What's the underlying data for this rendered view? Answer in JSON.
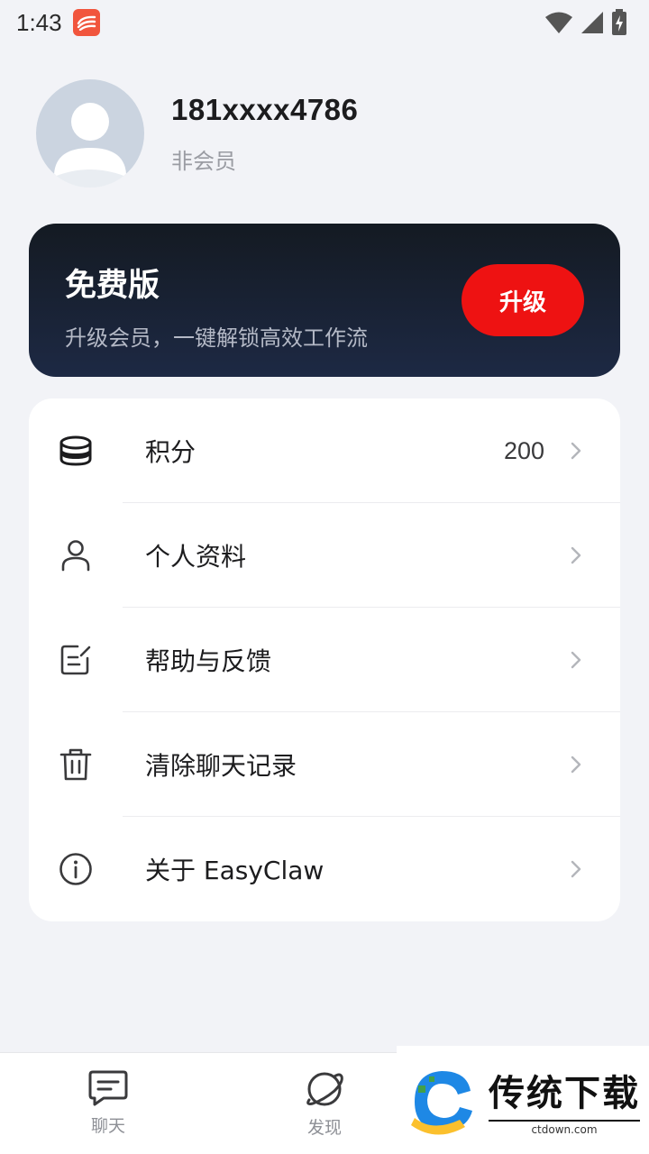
{
  "status_bar": {
    "time": "1:43",
    "icons": [
      "app-notification-icon",
      "wifi-icon",
      "cell-signal-icon",
      "battery-charging-icon"
    ]
  },
  "profile": {
    "username": "181xxxx4786",
    "member_status": "非会员",
    "avatar_icon": "user-avatar-placeholder-icon"
  },
  "plan_card": {
    "title": "免费版",
    "description": "升级会员，一键解锁高效工作流",
    "upgrade_label": "升级"
  },
  "menu": {
    "items": [
      {
        "label": "积分",
        "value": "200",
        "icon": "coins-stack-icon"
      },
      {
        "label": "个人资料",
        "value": "",
        "icon": "person-icon"
      },
      {
        "label": "帮助与反馈",
        "value": "",
        "icon": "edit-note-icon"
      },
      {
        "label": "清除聊天记录",
        "value": "",
        "icon": "trash-icon"
      },
      {
        "label": "关于 EasyClaw",
        "value": "",
        "icon": "info-icon"
      }
    ]
  },
  "bottom_nav": {
    "items": [
      {
        "label": "聊天",
        "icon": "chat-icon"
      },
      {
        "label": "发现",
        "icon": "planet-icon"
      }
    ]
  },
  "watermark": {
    "title": "传统下载",
    "subtitle": "ctdown.com"
  },
  "colors": {
    "accent_red": "#ee1212",
    "card_dark": "#1d2944",
    "background": "#f2f3f7"
  }
}
